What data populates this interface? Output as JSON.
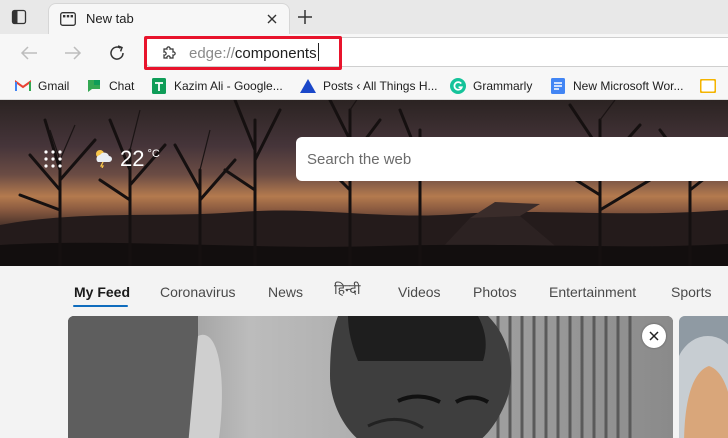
{
  "browser": {
    "tab": {
      "title": "New tab",
      "favicon": "new-tab-page-icon"
    },
    "new_tab_icon": "plus-icon",
    "address": {
      "scheme": "edge://",
      "path": "components"
    },
    "nav_icons": [
      "back-arrow-icon",
      "forward-arrow-icon",
      "refresh-icon",
      "puzzle-icon"
    ]
  },
  "bookmarks": [
    {
      "label": "Gmail",
      "icon": "gmail-icon"
    },
    {
      "label": "Chat",
      "icon": "chat-icon"
    },
    {
      "label": "Kazim Ali - Google...",
      "icon": "sheets-icon"
    },
    {
      "label": "Posts ‹ All Things H...",
      "icon": "triangle-icon"
    },
    {
      "label": "Grammarly",
      "icon": "grammarly-icon"
    },
    {
      "label": "New Microsoft Wor...",
      "icon": "docs-icon"
    }
  ],
  "hero": {
    "weather": {
      "temp": "22",
      "unit": "°C",
      "icon": "partly-cloudy-storm-icon"
    },
    "search": {
      "placeholder": "Search the web"
    }
  },
  "feed": {
    "tabs": [
      "My Feed",
      "Coronavirus",
      "News",
      "हिन्दी",
      "Videos",
      "Photos",
      "Entertainment",
      "Sports"
    ],
    "active_tab": "My Feed"
  },
  "colors": {
    "accent": "#0f6cbd",
    "highlight": "#e8142c"
  }
}
